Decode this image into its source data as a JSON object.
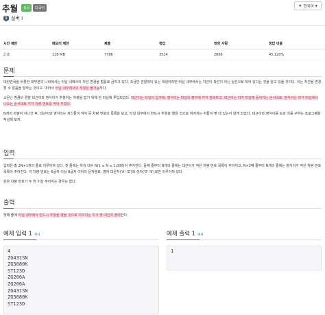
{
  "header": {
    "title": "추월",
    "badges": [
      "성공",
      "다국어"
    ],
    "language_button": "한국어"
  },
  "tier": {
    "icon_text": "1",
    "label": "실버 I"
  },
  "stats": {
    "headers": [
      "시간 제한",
      "메모리 제한",
      "제출",
      "정답",
      "맞힌 사람",
      "정답 비율"
    ],
    "values": [
      "2 초",
      "128 MB",
      "7786",
      "3514",
      "2866",
      "45.120%"
    ]
  },
  "problem": {
    "title": "문제",
    "p1_a": "대한민국을 비롯한 대부분의 나라에서는 터널 내에서의 차선 변경을 법률로 금하고 있다. 조금만 관찰력이 있는 학생이라면 터널 내부에서는 차선이 파선이 아닌 실선으로 되어 있다는 것을 알고 있을 것이다. 이는 차선을 변경할 수 없음을 말하는 것이고, 따라서 ",
    "p1_hl": "터널 내부에서의 추월은 불가능",
    "p1_b": "하다.",
    "p2_a": "소문난 명콤비 경찰 대근이와 영식이가 추월하는 차량을 잡기 위해 한 터널에 투입되었다. ",
    "p2_hl": "대근이는 터널의 입구에, 영식이는 터널의 출구에 각각 잠복하고, 대근이는 차가 터널에 들어가는 순서대로, 영식이는 차가 터널에서 나오는 순서대로 각각 차량 번호를 적어 두었다.",
    "p3": "N개의 차량이 지나간 후, 대근이와 영식이는 자신들이 적어 둔 차량 번호의 목록을 보고, 터널 내부에서 반드시 추월을 했을 것으로 여겨지는 차들이 몇 대 있는지 알게 되었다. 대근이와 영식이를 도와 이를 구하는 프로그램을 작성해 보자."
  },
  "input": {
    "title": "입력",
    "p1": "입력은 총 2N+1개의 줄로 이루어져 있다. 첫 줄에는 차의 대수 N(1 ≤ N ≤ 1,000)이 주어진다. 둘째 줄부터 N개의 줄에는 대근이가 적은 차량 번호 목록이 주어지고, N+2째 줄부터 N개의 줄에는 영식이가 적은 차량 번호 목록이 주어진다. 각 차량 번호는 6글자 이상 8글자 이하의 문자열로, 영어 대문자('A'-'Z')와 숫자('0'-'9')로만 이루어져 있다.",
    "p2": "같은 차량 번호가 두 번 이상 주어지는 경우는 없다."
  },
  "output": {
    "title": "출력",
    "p1_a": "첫째 줄에 ",
    "p1_hl": "터널 내부에서 반드시 추월을 했을 것으로 여겨지는 차가 몇 대인지 출력",
    "p1_b": "한다."
  },
  "example_input": {
    "title": "예제 입력 1",
    "copy": "복사",
    "lines": [
      "4",
      "ZG431SN",
      "ZG5080K",
      "ST123D",
      "ZG206A",
      "ZG206A",
      "ZG431SN",
      "ZG5080K",
      "ST123D"
    ]
  },
  "example_output": {
    "title": "예제 출력 1",
    "copy": "복사",
    "lines": [
      "1"
    ]
  }
}
